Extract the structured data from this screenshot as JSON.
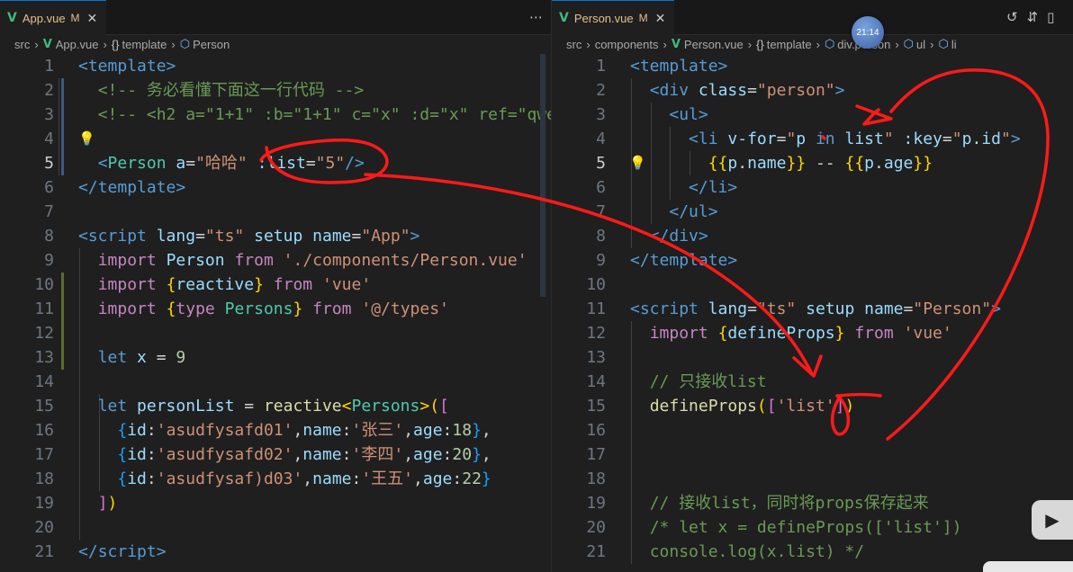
{
  "left": {
    "tab": {
      "label": "App.vue",
      "modified": "M",
      "close": "✕"
    },
    "breadcrumb": [
      "src",
      "App.vue",
      "template",
      "Person"
    ],
    "lines": [
      {
        "n": "1",
        "code": [
          [
            "tg",
            "<"
          ],
          [
            "tg",
            "template"
          ],
          [
            "tg",
            ">"
          ]
        ]
      },
      {
        "n": "2",
        "code": [
          [
            "pl",
            "  "
          ],
          [
            "cm",
            "<!-- 务必看懂下面这一行代码 -->"
          ]
        ]
      },
      {
        "n": "3",
        "code": [
          [
            "pl",
            "  "
          ],
          [
            "cm",
            "<!-- <h2 a=\"1+1\" :b=\"1+1\" c=\"x\" :d=\"x\" ref=\"qwe"
          ]
        ]
      },
      {
        "n": "4",
        "code": []
      },
      {
        "n": "5",
        "code": [
          [
            "pl",
            "  "
          ],
          [
            "tg",
            "<"
          ],
          [
            "nm",
            "Person"
          ],
          [
            "pl",
            " "
          ],
          [
            "at",
            "a"
          ],
          [
            "pl",
            "="
          ],
          [
            "st",
            "\"哈哈\""
          ],
          [
            "pl",
            " "
          ],
          [
            "at",
            ":list"
          ],
          [
            "pl",
            "="
          ],
          [
            "st",
            "\"5\""
          ],
          [
            "tg",
            "/>"
          ]
        ]
      },
      {
        "n": "6",
        "code": [
          [
            "tg",
            "</"
          ],
          [
            "tg",
            "template"
          ],
          [
            "tg",
            ">"
          ]
        ]
      },
      {
        "n": "7",
        "code": []
      },
      {
        "n": "8",
        "code": [
          [
            "tg",
            "<"
          ],
          [
            "tg",
            "script"
          ],
          [
            "pl",
            " "
          ],
          [
            "at",
            "lang"
          ],
          [
            "pl",
            "="
          ],
          [
            "st",
            "\"ts\""
          ],
          [
            "pl",
            " "
          ],
          [
            "at",
            "setup"
          ],
          [
            "pl",
            " "
          ],
          [
            "at",
            "name"
          ],
          [
            "pl",
            "="
          ],
          [
            "st",
            "\"App\""
          ],
          [
            "tg",
            ">"
          ]
        ]
      },
      {
        "n": "9",
        "code": [
          [
            "pl",
            "  "
          ],
          [
            "kw",
            "import"
          ],
          [
            "pl",
            " "
          ],
          [
            "vr",
            "Person"
          ],
          [
            "pl",
            " "
          ],
          [
            "kw",
            "from"
          ],
          [
            "pl",
            " "
          ],
          [
            "st",
            "'./components/Person.vue'"
          ]
        ]
      },
      {
        "n": "10",
        "code": [
          [
            "pl",
            "  "
          ],
          [
            "kw",
            "import"
          ],
          [
            "pl",
            " "
          ],
          [
            "b1",
            "{"
          ],
          [
            "vr",
            "reactive"
          ],
          [
            "b1",
            "}"
          ],
          [
            "pl",
            " "
          ],
          [
            "kw",
            "from"
          ],
          [
            "pl",
            " "
          ],
          [
            "st",
            "'vue'"
          ]
        ]
      },
      {
        "n": "11",
        "code": [
          [
            "pl",
            "  "
          ],
          [
            "kw",
            "import"
          ],
          [
            "pl",
            " "
          ],
          [
            "b1",
            "{"
          ],
          [
            "kw",
            "type"
          ],
          [
            "pl",
            " "
          ],
          [
            "ty",
            "Persons"
          ],
          [
            "b1",
            "}"
          ],
          [
            "pl",
            " "
          ],
          [
            "kw",
            "from"
          ],
          [
            "pl",
            " "
          ],
          [
            "st",
            "'@/types'"
          ]
        ]
      },
      {
        "n": "12",
        "code": []
      },
      {
        "n": "13",
        "code": [
          [
            "pl",
            "  "
          ],
          [
            "blue",
            "let"
          ],
          [
            "pl",
            " "
          ],
          [
            "vr",
            "x"
          ],
          [
            "pl",
            " = "
          ],
          [
            "nu",
            "9"
          ]
        ]
      },
      {
        "n": "14",
        "code": []
      },
      {
        "n": "15",
        "code": [
          [
            "pl",
            "  "
          ],
          [
            "blue",
            "let"
          ],
          [
            "pl",
            " "
          ],
          [
            "vr",
            "personList"
          ],
          [
            "pl",
            " = "
          ],
          [
            "fn",
            "reactive"
          ],
          [
            "b1",
            "<"
          ],
          [
            "ty",
            "Persons"
          ],
          [
            "b1",
            ">"
          ],
          [
            "b1",
            "("
          ],
          [
            "b2",
            "["
          ]
        ]
      },
      {
        "n": "16",
        "code": [
          [
            "pl",
            "    "
          ],
          [
            "b3",
            "{"
          ],
          [
            "vr",
            "id"
          ],
          [
            "pl",
            ":"
          ],
          [
            "st",
            "'asudfysafd01'"
          ],
          [
            "pl",
            ","
          ],
          [
            "vr",
            "name"
          ],
          [
            "pl",
            ":"
          ],
          [
            "st",
            "'张三'"
          ],
          [
            "pl",
            ","
          ],
          [
            "vr",
            "age"
          ],
          [
            "pl",
            ":"
          ],
          [
            "nu",
            "18"
          ],
          [
            "b3",
            "}"
          ],
          [
            "pl",
            ","
          ]
        ]
      },
      {
        "n": "17",
        "code": [
          [
            "pl",
            "    "
          ],
          [
            "b3",
            "{"
          ],
          [
            "vr",
            "id"
          ],
          [
            "pl",
            ":"
          ],
          [
            "st",
            "'asudfysafd02'"
          ],
          [
            "pl",
            ","
          ],
          [
            "vr",
            "name"
          ],
          [
            "pl",
            ":"
          ],
          [
            "st",
            "'李四'"
          ],
          [
            "pl",
            ","
          ],
          [
            "vr",
            "age"
          ],
          [
            "pl",
            ":"
          ],
          [
            "nu",
            "20"
          ],
          [
            "b3",
            "}"
          ],
          [
            "pl",
            ","
          ]
        ]
      },
      {
        "n": "18",
        "code": [
          [
            "pl",
            "    "
          ],
          [
            "b3",
            "{"
          ],
          [
            "vr",
            "id"
          ],
          [
            "pl",
            ":"
          ],
          [
            "st",
            "'asudfysaf)d03'"
          ],
          [
            "pl",
            ","
          ],
          [
            "vr",
            "name"
          ],
          [
            "pl",
            ":"
          ],
          [
            "st",
            "'王五'"
          ],
          [
            "pl",
            ","
          ],
          [
            "vr",
            "age"
          ],
          [
            "pl",
            ":"
          ],
          [
            "nu",
            "22"
          ],
          [
            "b3",
            "}"
          ]
        ]
      },
      {
        "n": "19",
        "code": [
          [
            "pl",
            "  "
          ],
          [
            "b2",
            "]"
          ],
          [
            "b1",
            ")"
          ]
        ]
      },
      {
        "n": "20",
        "code": []
      },
      {
        "n": "21",
        "code": [
          [
            "tg",
            "</"
          ],
          [
            "tg",
            "script"
          ],
          [
            "tg",
            ">"
          ]
        ]
      }
    ],
    "current_line": "5"
  },
  "right": {
    "tab": {
      "label": "Person.vue",
      "modified": "M",
      "close": "✕"
    },
    "breadcrumb": [
      "src",
      "components",
      "Person.vue",
      "template",
      "div.person",
      "ul",
      "li"
    ],
    "lines": [
      {
        "n": "1",
        "code": [
          [
            "tg",
            "<"
          ],
          [
            "tg",
            "template"
          ],
          [
            "tg",
            ">"
          ]
        ]
      },
      {
        "n": "2",
        "code": [
          [
            "pl",
            "  "
          ],
          [
            "tg",
            "<"
          ],
          [
            "tg",
            "div"
          ],
          [
            "pl",
            " "
          ],
          [
            "at",
            "class"
          ],
          [
            "pl",
            "="
          ],
          [
            "st",
            "\"person\""
          ],
          [
            "tg",
            ">"
          ]
        ]
      },
      {
        "n": "3",
        "code": [
          [
            "pl",
            "    "
          ],
          [
            "tg",
            "<"
          ],
          [
            "tg",
            "ul"
          ],
          [
            "tg",
            ">"
          ]
        ]
      },
      {
        "n": "4",
        "code": [
          [
            "pl",
            "      "
          ],
          [
            "tg",
            "<"
          ],
          [
            "tg",
            "li"
          ],
          [
            "pl",
            " "
          ],
          [
            "at",
            "v-for"
          ],
          [
            "pl",
            "="
          ],
          [
            "st",
            "\""
          ],
          [
            "vr",
            "p"
          ],
          [
            "pl",
            " "
          ],
          [
            "blue",
            "in"
          ],
          [
            "pl",
            " "
          ],
          [
            "vr",
            "list"
          ],
          [
            "st",
            "\""
          ],
          [
            "pl",
            " "
          ],
          [
            "at",
            ":key"
          ],
          [
            "pl",
            "="
          ],
          [
            "st",
            "\""
          ],
          [
            "vr",
            "p"
          ],
          [
            "pl",
            "."
          ],
          [
            "vr",
            "id"
          ],
          [
            "st",
            "\""
          ],
          [
            "tg",
            ">"
          ]
        ]
      },
      {
        "n": "5",
        "code": [
          [
            "pl",
            "        "
          ],
          [
            "b1",
            "{{"
          ],
          [
            "vr",
            "p"
          ],
          [
            "pl",
            "."
          ],
          [
            "vr",
            "name"
          ],
          [
            "b1",
            "}}"
          ],
          [
            "pl",
            " -- "
          ],
          [
            "b1",
            "{{"
          ],
          [
            "vr",
            "p"
          ],
          [
            "pl",
            "."
          ],
          [
            "vr",
            "age"
          ],
          [
            "b1",
            "}}"
          ]
        ]
      },
      {
        "n": "6",
        "code": [
          [
            "pl",
            "      "
          ],
          [
            "tg",
            "</"
          ],
          [
            "tg",
            "li"
          ],
          [
            "tg",
            ">"
          ]
        ]
      },
      {
        "n": "7",
        "code": [
          [
            "pl",
            "    "
          ],
          [
            "tg",
            "</"
          ],
          [
            "tg",
            "ul"
          ],
          [
            "tg",
            ">"
          ]
        ]
      },
      {
        "n": "8",
        "code": [
          [
            "pl",
            "  "
          ],
          [
            "tg",
            "</"
          ],
          [
            "tg",
            "div"
          ],
          [
            "tg",
            ">"
          ]
        ]
      },
      {
        "n": "9",
        "code": [
          [
            "tg",
            "</"
          ],
          [
            "tg",
            "template"
          ],
          [
            "tg",
            ">"
          ]
        ]
      },
      {
        "n": "10",
        "code": []
      },
      {
        "n": "11",
        "code": [
          [
            "tg",
            "<"
          ],
          [
            "tg",
            "script"
          ],
          [
            "pl",
            " "
          ],
          [
            "at",
            "lang"
          ],
          [
            "pl",
            "="
          ],
          [
            "st",
            "\"ts\""
          ],
          [
            "pl",
            " "
          ],
          [
            "at",
            "setup"
          ],
          [
            "pl",
            " "
          ],
          [
            "at",
            "name"
          ],
          [
            "pl",
            "="
          ],
          [
            "st",
            "\"Person\""
          ],
          [
            "tg",
            ">"
          ]
        ]
      },
      {
        "n": "12",
        "code": [
          [
            "pl",
            "  "
          ],
          [
            "kw",
            "import"
          ],
          [
            "pl",
            " "
          ],
          [
            "b1",
            "{"
          ],
          [
            "vr",
            "defineProps"
          ],
          [
            "b1",
            "}"
          ],
          [
            "pl",
            " "
          ],
          [
            "kw",
            "from"
          ],
          [
            "pl",
            " "
          ],
          [
            "st",
            "'vue'"
          ]
        ]
      },
      {
        "n": "13",
        "code": []
      },
      {
        "n": "14",
        "code": [
          [
            "pl",
            "  "
          ],
          [
            "cm",
            "// 只接收list"
          ]
        ]
      },
      {
        "n": "15",
        "code": [
          [
            "pl",
            "  "
          ],
          [
            "fn",
            "defineProps"
          ],
          [
            "b1",
            "("
          ],
          [
            "b2",
            "["
          ],
          [
            "st",
            "'list'"
          ],
          [
            "b2",
            "]"
          ],
          [
            "b1",
            ")"
          ]
        ]
      },
      {
        "n": "16",
        "code": []
      },
      {
        "n": "17",
        "code": []
      },
      {
        "n": "18",
        "code": []
      },
      {
        "n": "19",
        "code": [
          [
            "pl",
            "  "
          ],
          [
            "cm",
            "// 接收list，同时将props保存起来"
          ]
        ]
      },
      {
        "n": "20",
        "code": [
          [
            "pl",
            "  "
          ],
          [
            "cm",
            "/* let x = defineProps(['list'])"
          ]
        ]
      },
      {
        "n": "21",
        "code": [
          [
            "pl",
            "  "
          ],
          [
            "cm",
            "console.log(x.list) */"
          ]
        ]
      }
    ],
    "current_line": "5"
  },
  "overlay": {
    "clock_time": "21:14"
  },
  "colors": {
    "accent": "#0078d4",
    "vue_green": "#41b883",
    "annotation_red": "#ff1a1a"
  }
}
